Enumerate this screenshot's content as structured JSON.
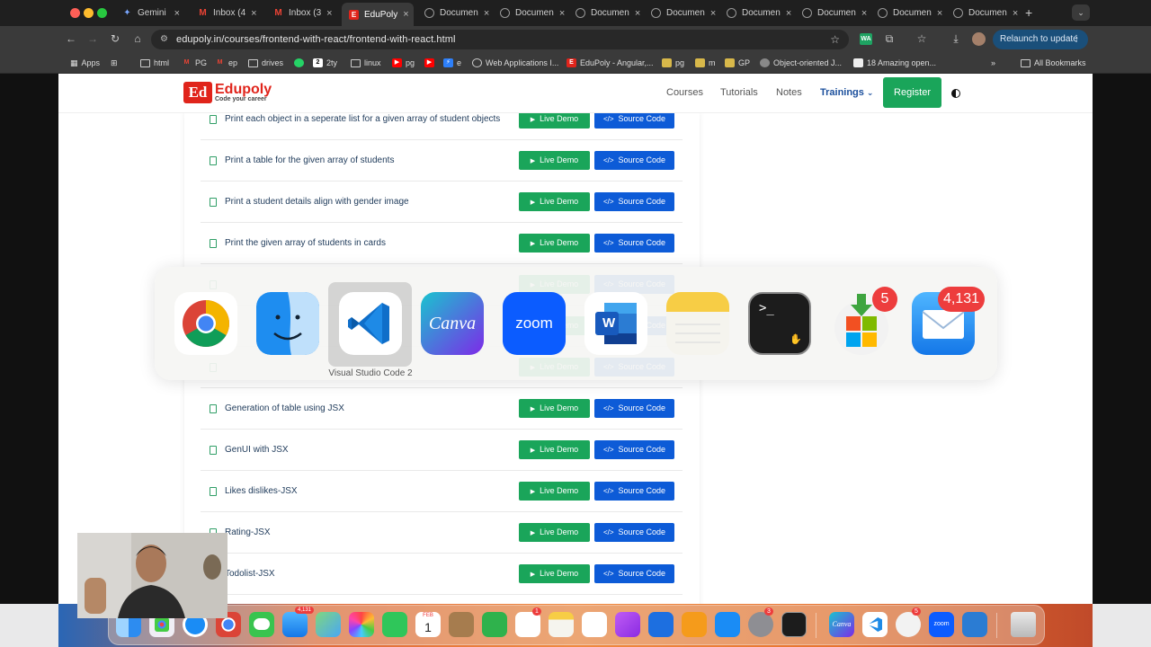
{
  "browser": {
    "tabs": [
      {
        "label": "Gemini",
        "active": false
      },
      {
        "label": "Inbox (4",
        "active": false
      },
      {
        "label": "Inbox (3",
        "active": false
      },
      {
        "label": "EduPoly",
        "active": true
      },
      {
        "label": "Documen",
        "active": false
      },
      {
        "label": "Documen",
        "active": false
      },
      {
        "label": "Documen",
        "active": false
      },
      {
        "label": "Documen",
        "active": false
      },
      {
        "label": "Documen",
        "active": false
      },
      {
        "label": "Documen",
        "active": false
      },
      {
        "label": "Documen",
        "active": false
      },
      {
        "label": "Documen",
        "active": false
      }
    ],
    "new_tab": "+",
    "url": "edupoly.in/courses/frontend-with-react/frontend-with-react.html",
    "relaunch_label": "Relaunch to update",
    "bookmarks": [
      {
        "label": "Apps"
      },
      {
        "label": ""
      },
      {
        "label": "html"
      },
      {
        "label": "PG"
      },
      {
        "label": "ep"
      },
      {
        "label": "drives"
      },
      {
        "label": ""
      },
      {
        "label": "2ty"
      },
      {
        "label": "linux"
      },
      {
        "label": "pg"
      },
      {
        "label": ""
      },
      {
        "label": "e"
      },
      {
        "label": "Web Applications I..."
      },
      {
        "label": "EduPoly - Angular,..."
      },
      {
        "label": "pg"
      },
      {
        "label": "m"
      },
      {
        "label": "GP"
      },
      {
        "label": "Object-oriented J..."
      },
      {
        "label": "18 Amazing open..."
      }
    ],
    "all_bookmarks": "All Bookmarks"
  },
  "site": {
    "logo_mark": "Ed",
    "logo_name": "Edupoly",
    "logo_tagline": "Code your career",
    "nav": [
      "Courses",
      "Tutorials",
      "Notes",
      "Trainings"
    ],
    "register": "Register",
    "accent": "#1aa55a",
    "link_blue": "#0d5bd7"
  },
  "lessons": [
    {
      "title": "Print each object in a seperate list for a given array of student objects"
    },
    {
      "title": "Print a table for the given array of students"
    },
    {
      "title": "Print a student details align with gender image"
    },
    {
      "title": "Print the given array of students in cards"
    },
    {
      "title": ""
    },
    {
      "title": ""
    },
    {
      "title": ""
    },
    {
      "title": "Generation of table using JSX"
    },
    {
      "title": "GenUI with JSX"
    },
    {
      "title": "Likes dislikes-JSX"
    },
    {
      "title": "Rating-JSX"
    },
    {
      "title": "Todolist-JSX"
    }
  ],
  "buttons": {
    "live_demo": "Live Demo",
    "source_code": "Source Code"
  },
  "switcher": {
    "apps": [
      "Chrome",
      "Finder",
      "Visual Studio Code 2",
      "Canva",
      "zoom",
      "Word",
      "Notes",
      "Terminal",
      "Microsoft AutoUpdate",
      "Mail"
    ],
    "selected_label": "Visual Studio Code 2",
    "canva_label": "Canva",
    "zoom_label": "zoom",
    "word_letter": "W",
    "terminal_prompt": ">_",
    "badges": {
      "autoupdate": "5",
      "mail": "4,131"
    }
  },
  "dock": {
    "mail_badge": "4,131",
    "reminders_badge": "1",
    "settings_badge": "3",
    "office_badge": "5",
    "calendar_month": "FEB",
    "calendar_day": "1",
    "zoom_label": "zoom",
    "canva_label": "Canva"
  },
  "back_to_top": "↑"
}
